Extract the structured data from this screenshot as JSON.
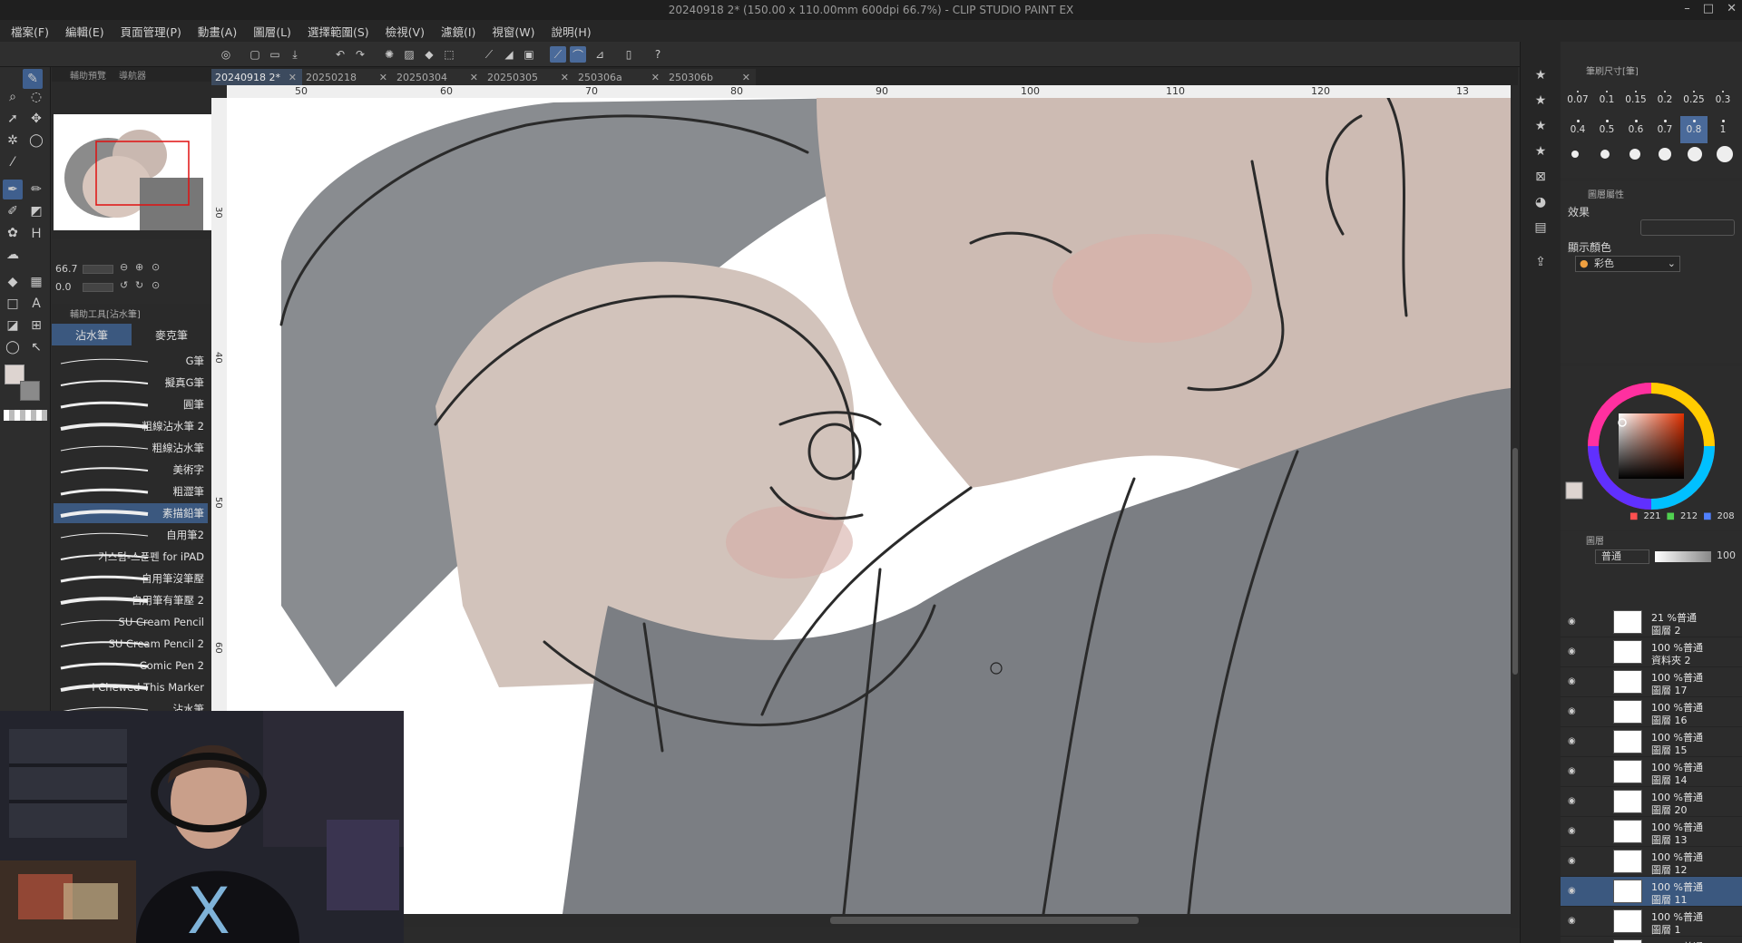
{
  "window": {
    "title": "20240918 2* (150.00 x 110.00mm 600dpi 66.7%) - CLIP STUDIO PAINT EX",
    "controls": [
      "–",
      "□",
      "✕"
    ]
  },
  "menu": [
    "檔案(F)",
    "編輯(E)",
    "頁面管理(P)",
    "動畫(A)",
    "圖層(L)",
    "選擇範圍(S)",
    "檢視(V)",
    "濾鏡(I)",
    "視窗(W)",
    "說明(H)"
  ],
  "navigator": {
    "tabs": [
      "輔助預覽",
      "導航器"
    ],
    "zoom": "66.7",
    "angle": "0.0"
  },
  "subtool": {
    "header": "輔助工具[沾水筆]",
    "tabs": [
      "沾水筆",
      "麥克筆"
    ],
    "active_tab": 0,
    "brushes": [
      "G筆",
      "擬真G筆",
      "圓筆",
      "粗線沾水筆 2",
      "粗線沾水筆",
      "美術字",
      "粗澀筆",
      "素描鉛筆",
      "自用筆2",
      "커스텀-스푼펜 for iPAD",
      "自用筆沒筆壓",
      "自用筆有筆壓 2",
      "SU Cream Pencil",
      "SU Cream Pencil 2",
      "Comic Pen 2",
      "I Chewed This Marker",
      "沾水筆"
    ],
    "active_brush": 7
  },
  "documents": {
    "tabs": [
      "20240918 2*",
      "20250218",
      "20250304",
      "20250305",
      "250306a",
      "250306b"
    ],
    "active": 0,
    "close": "✕"
  },
  "rulers": {
    "top": [
      "50",
      "60",
      "70",
      "80",
      "90",
      "100",
      "110",
      "120",
      "13"
    ],
    "left": [
      "30",
      "40",
      "50",
      "60"
    ]
  },
  "brush_size": {
    "header": "筆刷尺寸[筆]",
    "sizes": [
      "0.07",
      "0.1",
      "0.15",
      "0.2",
      "0.25",
      "0.3",
      "0.4",
      "0.5",
      "0.6",
      "0.7",
      "0.8",
      "1"
    ],
    "active": 10
  },
  "layer_property": {
    "header": "圖層屬性",
    "effect_label": "效果",
    "display_color_label": "顯示顏色",
    "display_color_value": "彩色"
  },
  "color": {
    "r": "221",
    "g": "212",
    "b": "208",
    "main_hex": "#ddd4d0"
  },
  "layers": {
    "header": "圖層",
    "blend_mode": "普通",
    "opacity": "100",
    "items": [
      {
        "line1": "21 %普通",
        "line2": "圖層 2"
      },
      {
        "line1": "100 %普通",
        "line2": "資料夾 2"
      },
      {
        "line1": "100 %普通",
        "line2": "圖層 17"
      },
      {
        "line1": "100 %普通",
        "line2": "圖層 16"
      },
      {
        "line1": "100 %普通",
        "line2": "圖層 15"
      },
      {
        "line1": "100 %普通",
        "line2": "圖層 14"
      },
      {
        "line1": "100 %普通",
        "line2": "圖層 20"
      },
      {
        "line1": "100 %普通",
        "line2": "圖層 13"
      },
      {
        "line1": "100 %普通",
        "line2": "圖層 12"
      },
      {
        "line1": "100 %普通",
        "line2": "圖層 11"
      },
      {
        "line1": "100 %普通",
        "line2": "圖層 1"
      },
      {
        "line1": "100 %普通",
        "line2": ""
      }
    ],
    "active": 9
  }
}
